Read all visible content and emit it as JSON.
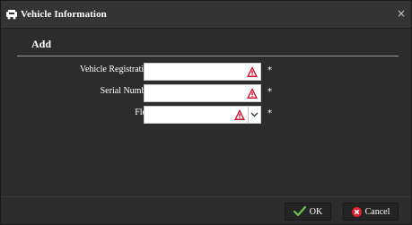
{
  "window": {
    "title": "Vehicle Information",
    "title_icon": "vehicle-icon",
    "close_glyph": "×"
  },
  "form": {
    "section_title": "Add",
    "fields": [
      {
        "label": "Vehicle Registration:",
        "value": "",
        "required_mark": "*",
        "status_icon": "warning-icon"
      },
      {
        "label": "Serial Number:",
        "value": "",
        "required_mark": "*",
        "status_icon": "warning-icon"
      },
      {
        "label": "Fleet:",
        "value": "",
        "required_mark": "*",
        "status_icon": "warning-icon",
        "type": "select"
      }
    ]
  },
  "buttons": {
    "ok_label": "OK",
    "cancel_label": "Cancel"
  },
  "colors": {
    "background": "#2c2c2c",
    "warning": "#c8102e",
    "ok_check": "#6cc24a",
    "cancel_icon": "#e0202a"
  }
}
